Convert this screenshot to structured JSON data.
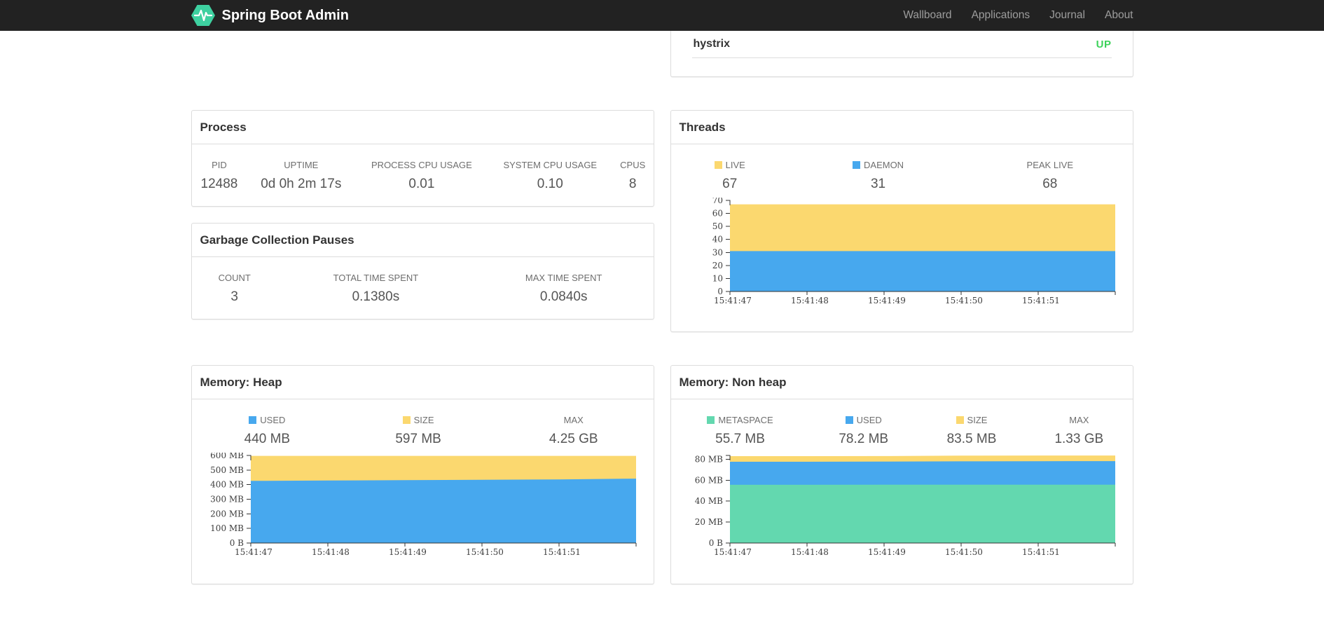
{
  "navbar": {
    "brand": "Spring Boot Admin",
    "links": [
      {
        "label": "Wallboard"
      },
      {
        "label": "Applications"
      },
      {
        "label": "Journal"
      },
      {
        "label": "About"
      }
    ]
  },
  "colors": {
    "navbar_bg": "#222222",
    "logo_green": "#3ED0A0",
    "status_up": "#3CD25A",
    "series_yellow": "#FBD86F",
    "series_blue": "#47A8EE",
    "series_green": "#63D8AF"
  },
  "application": {
    "name": "hystrix",
    "status": "UP"
  },
  "process": {
    "title": "Process",
    "stats": [
      {
        "label": "PID",
        "value": "12488"
      },
      {
        "label": "UPTIME",
        "value": "0d 0h 2m 17s"
      },
      {
        "label": "PROCESS CPU USAGE",
        "value": "0.01"
      },
      {
        "label": "SYSTEM CPU USAGE",
        "value": "0.10"
      },
      {
        "label": "CPUS",
        "value": "8"
      }
    ]
  },
  "gc": {
    "title": "Garbage Collection Pauses",
    "stats": [
      {
        "label": "COUNT",
        "value": "3"
      },
      {
        "label": "TOTAL TIME SPENT",
        "value": "0.1380s"
      },
      {
        "label": "MAX TIME SPENT",
        "value": "0.0840s"
      }
    ]
  },
  "threads": {
    "title": "Threads",
    "stats": [
      {
        "label": "LIVE",
        "value": "67",
        "swatch": "#FBD86F"
      },
      {
        "label": "DAEMON",
        "value": "31",
        "swatch": "#47A8EE"
      },
      {
        "label": "PEAK LIVE",
        "value": "68"
      }
    ]
  },
  "memory_heap": {
    "title": "Memory: Heap",
    "stats": [
      {
        "label": "USED",
        "value": "440 MB",
        "swatch": "#47A8EE"
      },
      {
        "label": "SIZE",
        "value": "597 MB",
        "swatch": "#FBD86F"
      },
      {
        "label": "MAX",
        "value": "4.25 GB"
      }
    ]
  },
  "memory_non_heap": {
    "title": "Memory: Non heap",
    "stats": [
      {
        "label": "METASPACE",
        "value": "55.7 MB",
        "swatch": "#63D8AF"
      },
      {
        "label": "USED",
        "value": "78.2 MB",
        "swatch": "#47A8EE"
      },
      {
        "label": "SIZE",
        "value": "83.5 MB",
        "swatch": "#FBD86F"
      },
      {
        "label": "MAX",
        "value": "1.33 GB"
      }
    ]
  },
  "chart_data": [
    {
      "id": "threads",
      "type": "area",
      "stacked": true,
      "title": "Threads",
      "x_domain": [
        0,
        5
      ],
      "x_samples": [
        0,
        1,
        2,
        3,
        4,
        5
      ],
      "x_ticks": [
        {
          "s": 0,
          "label": "15:41:47"
        },
        {
          "s": 1,
          "label": "15:41:48"
        },
        {
          "s": 2,
          "label": "15:41:49"
        },
        {
          "s": 3,
          "label": "15:41:50"
        },
        {
          "s": 4,
          "label": "15:41:51"
        }
      ],
      "ylim": [
        0,
        70
      ],
      "ymax_render": 70,
      "y_ticks": [
        {
          "v": 0,
          "label": "0"
        },
        {
          "v": 10,
          "label": "10"
        },
        {
          "v": 20,
          "label": "20"
        },
        {
          "v": 30,
          "label": "30"
        },
        {
          "v": 40,
          "label": "40"
        },
        {
          "v": 50,
          "label": "50"
        },
        {
          "v": 60,
          "label": "60"
        },
        {
          "v": 70,
          "label": "70"
        }
      ],
      "series": [
        {
          "name": "DAEMON",
          "color": "#47A8EE",
          "tops": [
            31,
            31,
            31,
            31,
            31,
            31
          ]
        },
        {
          "name": "LIVE",
          "color": "#FBD86F",
          "tops": [
            67,
            67,
            67,
            67,
            67,
            67
          ]
        }
      ]
    },
    {
      "id": "heap",
      "type": "area",
      "stacked": true,
      "title": "Memory: Heap",
      "x_domain": [
        0,
        5
      ],
      "x_samples": [
        0,
        1,
        2,
        3,
        4,
        5
      ],
      "x_ticks": [
        {
          "s": 0,
          "label": "15:41:47"
        },
        {
          "s": 1,
          "label": "15:41:48"
        },
        {
          "s": 2,
          "label": "15:41:49"
        },
        {
          "s": 3,
          "label": "15:41:50"
        },
        {
          "s": 4,
          "label": "15:41:51"
        }
      ],
      "ylim": [
        0,
        600
      ],
      "ymax_render": 600,
      "y_ticks": [
        {
          "v": 0,
          "label": "0 B"
        },
        {
          "v": 100,
          "label": "100 MB"
        },
        {
          "v": 200,
          "label": "200 MB"
        },
        {
          "v": 300,
          "label": "300 MB"
        },
        {
          "v": 400,
          "label": "400 MB"
        },
        {
          "v": 500,
          "label": "500 MB"
        },
        {
          "v": 600,
          "label": "600 MB"
        }
      ],
      "series": [
        {
          "name": "USED",
          "color": "#47A8EE",
          "tops": [
            426,
            428,
            431,
            433,
            436,
            441
          ]
        },
        {
          "name": "SIZE",
          "color": "#FBD86F",
          "tops": [
            597,
            597,
            597,
            597,
            597,
            597
          ]
        }
      ]
    },
    {
      "id": "nonheap",
      "type": "area",
      "stacked": true,
      "title": "Memory: Non heap",
      "x_domain": [
        0,
        5
      ],
      "x_samples": [
        0,
        1,
        2,
        3,
        4,
        5
      ],
      "x_ticks": [
        {
          "s": 0,
          "label": "15:41:47"
        },
        {
          "s": 1,
          "label": "15:41:48"
        },
        {
          "s": 2,
          "label": "15:41:49"
        },
        {
          "s": 3,
          "label": "15:41:50"
        },
        {
          "s": 4,
          "label": "15:41:51"
        }
      ],
      "ylim": [
        0,
        80
      ],
      "ymax_render": 83.6,
      "y_ticks": [
        {
          "v": 0,
          "label": "0 B"
        },
        {
          "v": 20,
          "label": "20 MB"
        },
        {
          "v": 40,
          "label": "40 MB"
        },
        {
          "v": 60,
          "label": "60 MB"
        },
        {
          "v": 80,
          "label": "80 MB"
        }
      ],
      "series": [
        {
          "name": "METASPACE",
          "color": "#63D8AF",
          "tops": [
            55.6,
            55.6,
            55.7,
            55.7,
            55.7,
            55.7
          ]
        },
        {
          "name": "USED",
          "color": "#47A8EE",
          "tops": [
            77.6,
            77.6,
            77.7,
            78.0,
            78.1,
            78.2
          ]
        },
        {
          "name": "SIZE",
          "color": "#FBD86F",
          "tops": [
            82.9,
            82.9,
            83.0,
            83.4,
            83.5,
            83.5
          ]
        }
      ]
    }
  ]
}
